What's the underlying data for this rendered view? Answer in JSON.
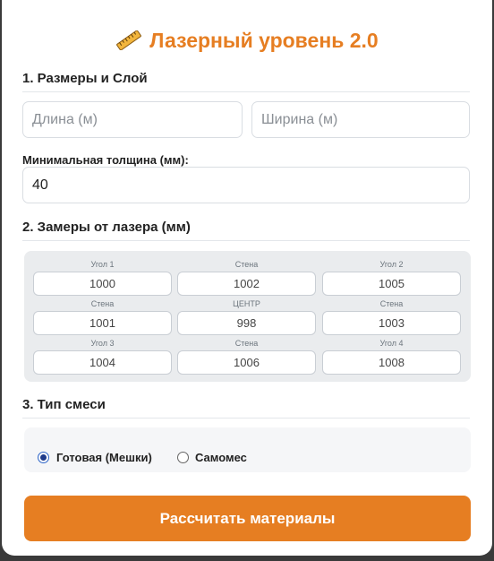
{
  "header": {
    "title": "Лазерный уровень 2.0",
    "icon": "ruler-icon"
  },
  "section1": {
    "title": "1. Размеры и Слой",
    "length_placeholder": "Длина (м)",
    "length_value": "",
    "width_placeholder": "Ширина (м)",
    "width_value": "",
    "thickness_label": "Минимальная толщина (мм):",
    "thickness_value": "40"
  },
  "section2": {
    "title": "2. Замеры от лазера (мм)",
    "cells": [
      {
        "label": "Угол 1",
        "value": "1000"
      },
      {
        "label": "Стена",
        "value": "1002"
      },
      {
        "label": "Угол 2",
        "value": "1005"
      },
      {
        "label": "Стена",
        "value": "1001"
      },
      {
        "label": "ЦЕНТР",
        "value": "998"
      },
      {
        "label": "Стена",
        "value": "1003"
      },
      {
        "label": "Угол 3",
        "value": "1004"
      },
      {
        "label": "Стена",
        "value": "1006"
      },
      {
        "label": "Угол 4",
        "value": "1008"
      }
    ]
  },
  "section3": {
    "title": "3. Тип смеси",
    "options": [
      {
        "label": "Готовая (Мешки)",
        "checked": true
      },
      {
        "label": "Самомес",
        "checked": false
      }
    ]
  },
  "action": {
    "calculate_label": "Рассчитать материалы"
  },
  "colors": {
    "accent": "#e67e22",
    "background": "#ffffff"
  }
}
